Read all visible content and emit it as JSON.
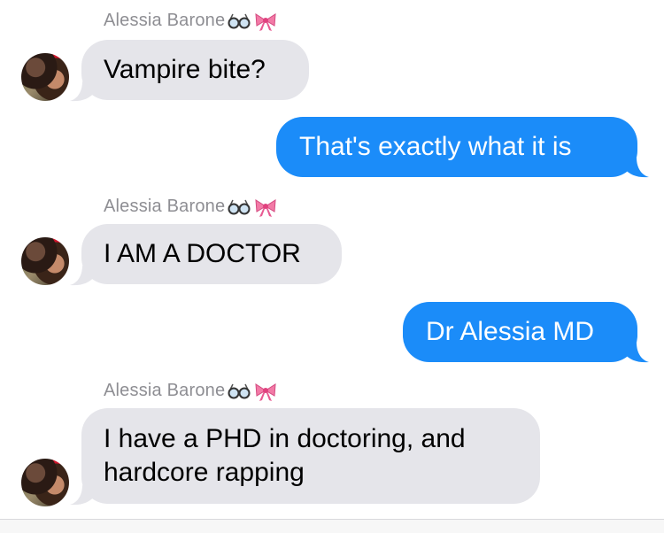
{
  "conversation": {
    "messages": [
      {
        "direction": "incoming",
        "sender": "Alessia Barone",
        "text": "Vampire bite?"
      },
      {
        "direction": "outgoing",
        "text": "That's exactly what it is"
      },
      {
        "direction": "incoming",
        "sender": "Alessia Barone",
        "text": "I AM A DOCTOR"
      },
      {
        "direction": "outgoing",
        "text": "Dr Alessia MD"
      },
      {
        "direction": "incoming",
        "sender": "Alessia Barone",
        "text_lines": [
          "I have a PHD in doctoring, and",
          "hardcore rapping"
        ]
      }
    ],
    "sender_emojis": [
      "glasses-emoji",
      "ribbon-emoji"
    ]
  },
  "colors": {
    "incoming_bubble": "#e5e5ea",
    "outgoing_bubble": "#1b8cf9",
    "sender_name": "#8e8e93"
  }
}
